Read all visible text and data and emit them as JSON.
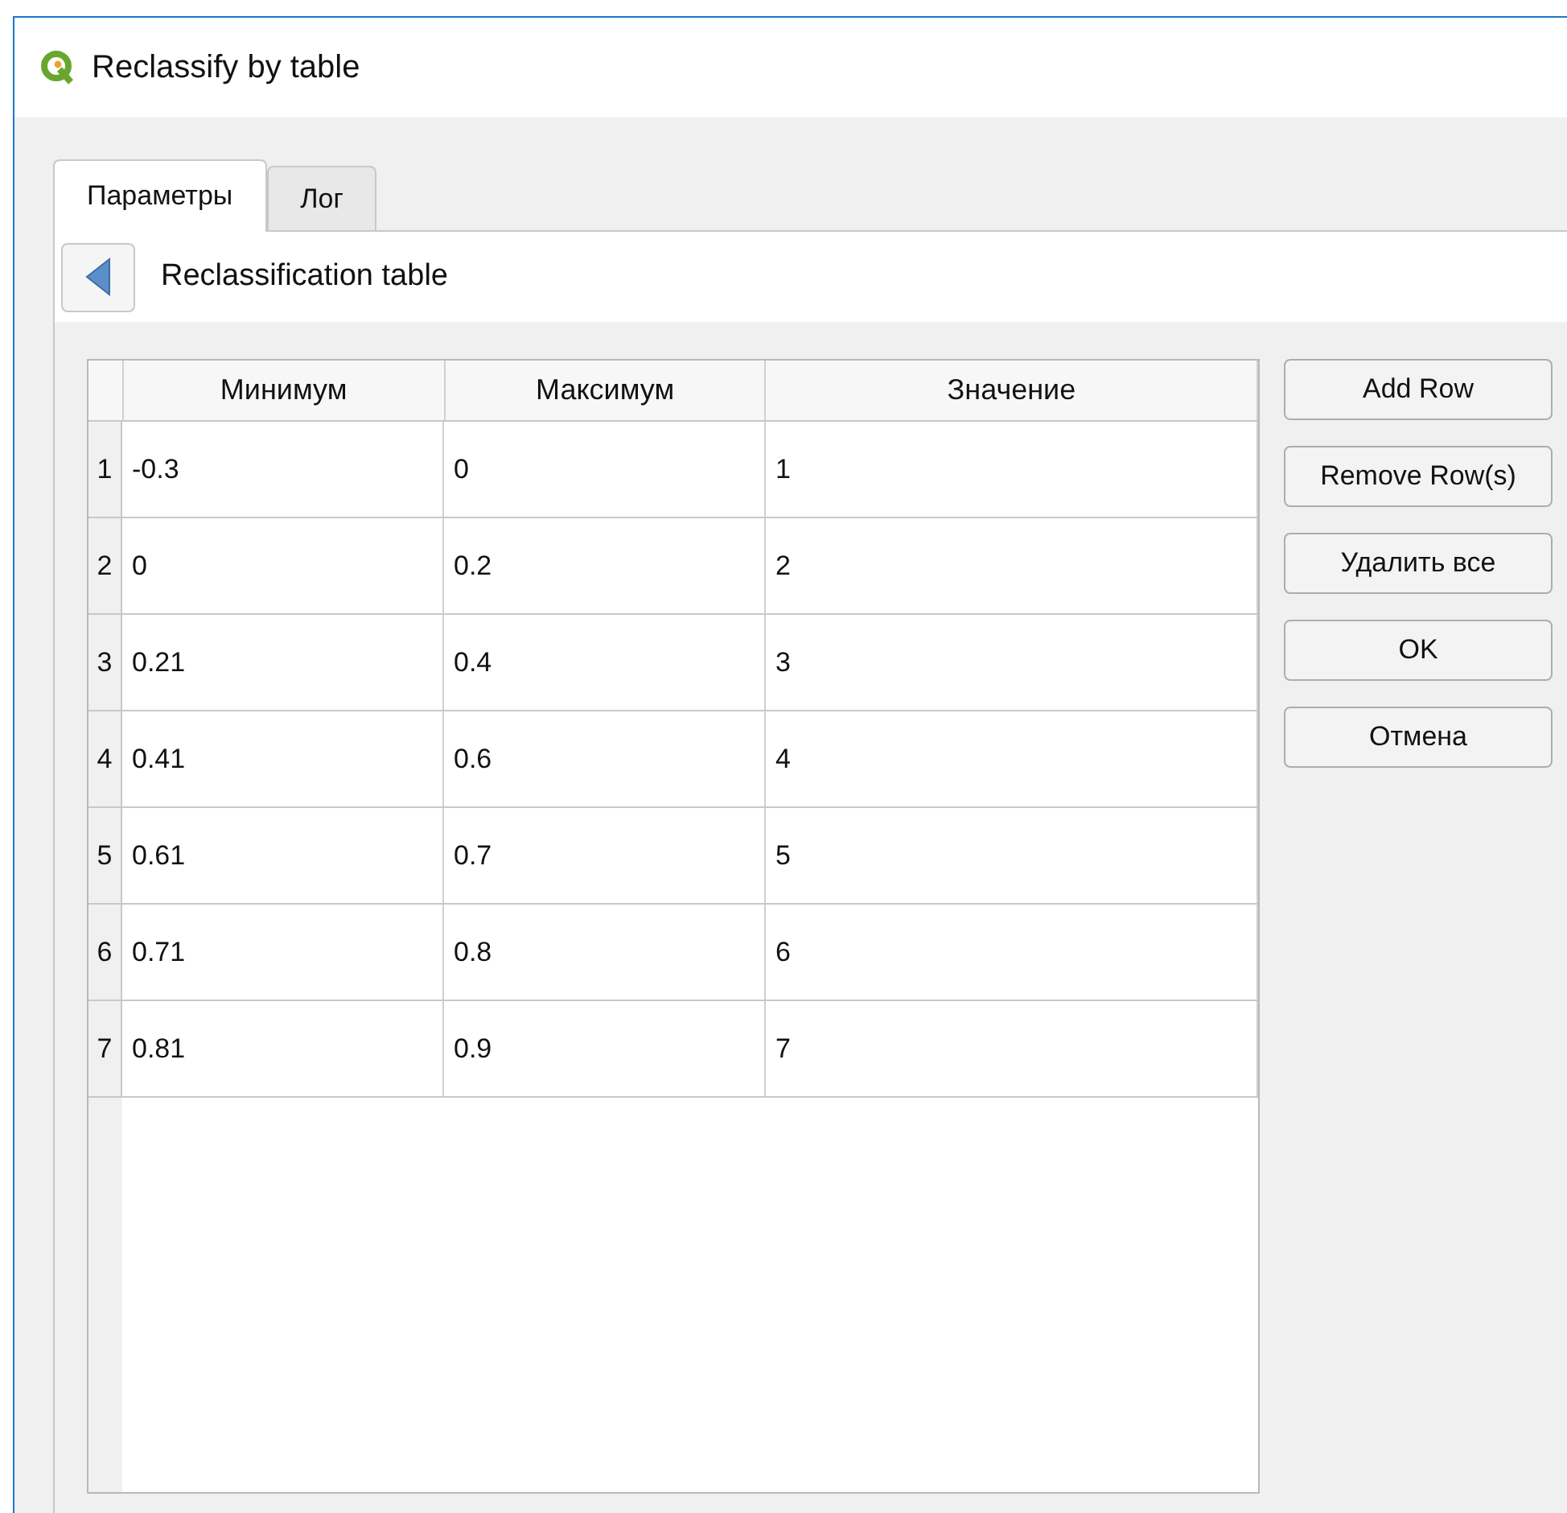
{
  "window": {
    "title": "Reclassify by table"
  },
  "tabs": [
    {
      "label": "Параметры",
      "selected": true
    },
    {
      "label": "Лог",
      "selected": false
    }
  ],
  "header": {
    "title": "Reclassification table"
  },
  "table": {
    "columns": [
      "Минимум",
      "Максимум",
      "Значение"
    ],
    "rows": [
      {
        "number": "1",
        "cells": [
          "-0.3",
          "0",
          "1"
        ]
      },
      {
        "number": "2",
        "cells": [
          "0",
          "0.2",
          "2"
        ]
      },
      {
        "number": "3",
        "cells": [
          "0.21",
          "0.4",
          "3"
        ]
      },
      {
        "number": "4",
        "cells": [
          "0.41",
          "0.6",
          "4"
        ]
      },
      {
        "number": "5",
        "cells": [
          "0.61",
          "0.7",
          "5"
        ]
      },
      {
        "number": "6",
        "cells": [
          "0.71",
          "0.8",
          "6"
        ]
      },
      {
        "number": "7",
        "cells": [
          "0.81",
          "0.9",
          "7"
        ]
      }
    ]
  },
  "buttons": [
    "Add Row",
    "Remove Row(s)",
    "Удалить все",
    "OK",
    "Отмена"
  ]
}
